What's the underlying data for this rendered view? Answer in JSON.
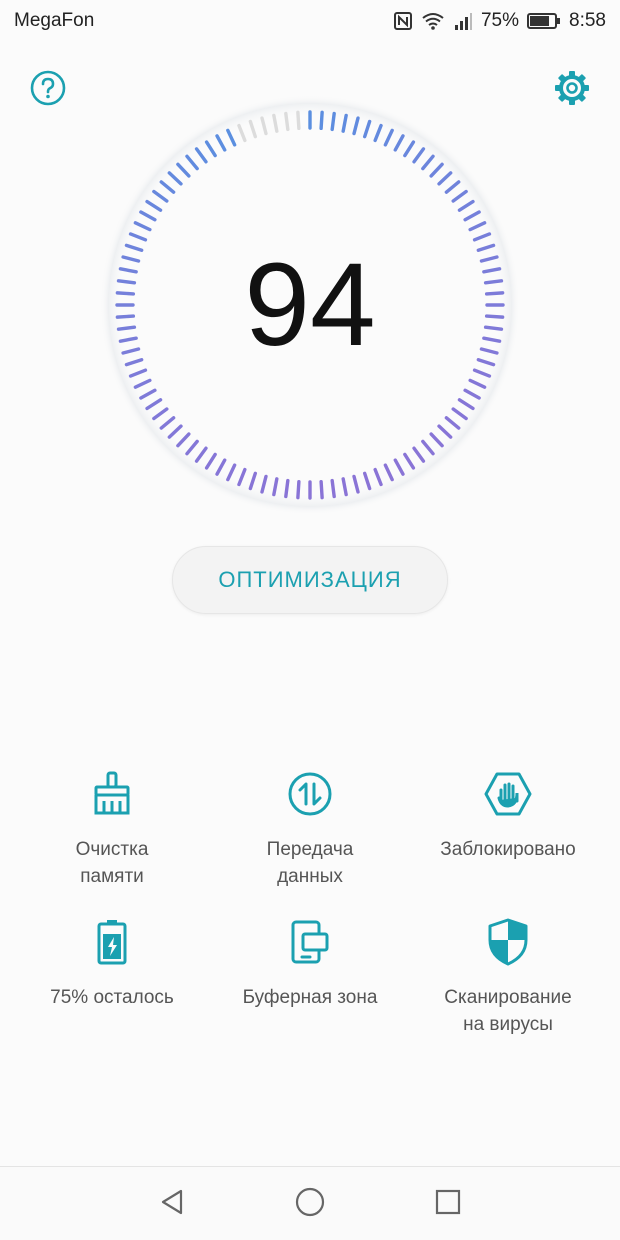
{
  "status_bar": {
    "carrier": "MegaFon",
    "battery_percent": "75%",
    "time": "8:58"
  },
  "score": {
    "value": "94",
    "fraction": 0.94
  },
  "optimize_button": {
    "label": "ОПТИМИЗАЦИЯ"
  },
  "features": [
    {
      "label": "Очистка\nпамяти",
      "icon": "broom-icon"
    },
    {
      "label": "Передача\nданных",
      "icon": "data-transfer-icon"
    },
    {
      "label": "Заблокировано",
      "icon": "blocked-hand-icon"
    },
    {
      "label": "75% осталось",
      "icon": "battery-icon"
    },
    {
      "label": "Буферная зона",
      "icon": "buffer-zone-icon"
    },
    {
      "label": "Сканирование\nна вирусы",
      "icon": "shield-icon"
    }
  ],
  "colors": {
    "accent": "#1ba0b0",
    "dial_start": "#5b8fe0",
    "dial_end": "#8a74d6",
    "dial_inactive": "#dcdcdc"
  }
}
